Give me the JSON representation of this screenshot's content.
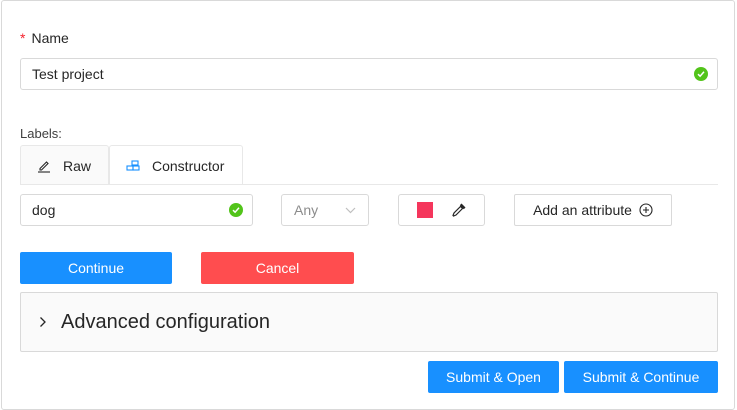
{
  "name_field": {
    "required_mark": "*",
    "label": "Name",
    "value": "Test project"
  },
  "labels": {
    "title": "Labels:",
    "tabs": [
      {
        "label": "Raw"
      },
      {
        "label": "Constructor"
      }
    ],
    "constructor": {
      "label_name": "dog",
      "type_select": "Any",
      "color": "#f5365c",
      "add_attribute": "Add an attribute"
    }
  },
  "actions": {
    "continue": "Continue",
    "cancel": "Cancel"
  },
  "advanced": {
    "title": "Advanced configuration"
  },
  "footer": {
    "submit_open": "Submit & Open",
    "submit_continue": "Submit & Continue"
  }
}
